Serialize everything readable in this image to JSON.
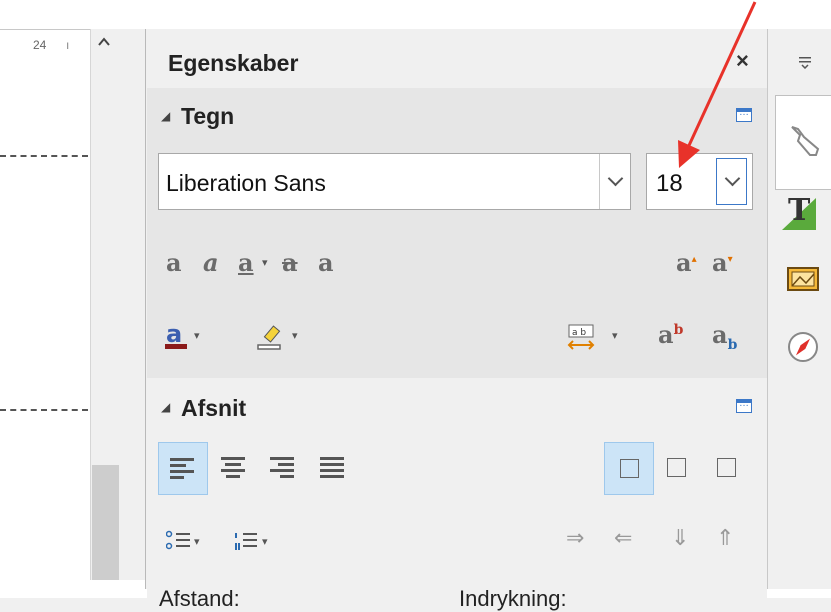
{
  "ruler": {
    "number": "24",
    "tick": "ı"
  },
  "sidebar": {
    "title": "Egenskaber",
    "close_label": "×",
    "character_section": {
      "title": "Tegn",
      "font_name": "Liberation Sans",
      "font_size": "18",
      "more_options_icon": "more-options-icon"
    },
    "paragraph_section": {
      "title": "Afsnit",
      "labels": {
        "spacing": "Afstand:",
        "indent": "Indrykning:"
      }
    }
  },
  "tabs": [
    "properties-tab",
    "styles-tab",
    "gallery-tab",
    "navigator-tab"
  ],
  "annotation": {
    "color": "#e8322a"
  },
  "colors": {
    "font_color": "#8b1a1a",
    "highlight": "#f5d33a",
    "selection_bg": "#cce4f7",
    "accent": "#3c78c8"
  }
}
